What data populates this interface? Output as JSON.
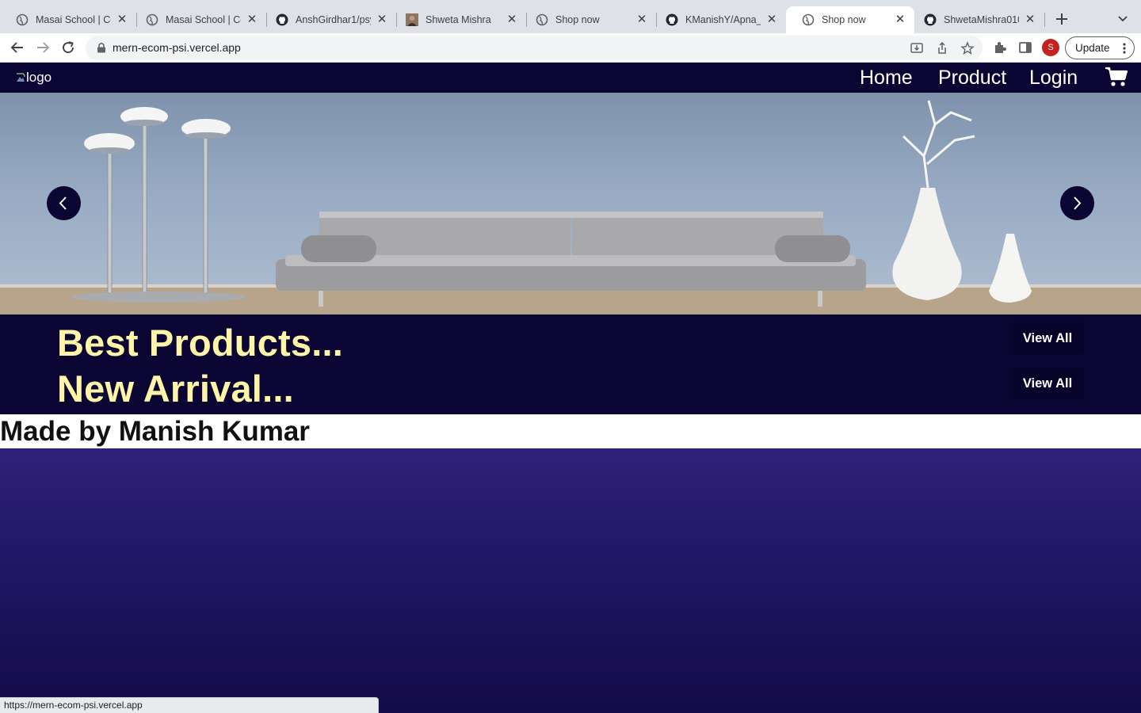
{
  "browser": {
    "tabs": [
      {
        "title": "Masai School | Co",
        "icon": "globe-icon",
        "active": false
      },
      {
        "title": "Masai School | Co",
        "icon": "globe-icon",
        "active": false
      },
      {
        "title": "AnshGirdhar1/psy",
        "icon": "github-icon",
        "active": false
      },
      {
        "title": "Shweta Mishra",
        "icon": "profile-photo-icon",
        "active": false
      },
      {
        "title": "Shop now",
        "icon": "globe-icon",
        "active": false
      },
      {
        "title": "KManishY/Apna_",
        "icon": "github-icon",
        "active": false
      },
      {
        "title": "Shop now",
        "icon": "globe-icon",
        "active": true
      },
      {
        "title": "ShwetaMishra010",
        "icon": "github-icon",
        "active": false
      }
    ],
    "url": "mern-ecom-psi.vercel.app",
    "profile_initial": "S",
    "update_label": "Update",
    "status_url": "https://mern-ecom-psi.vercel.app"
  },
  "site": {
    "logo_alt": "logo",
    "nav": {
      "home": "Home",
      "product": "Product",
      "login": "Login"
    },
    "sections": [
      {
        "title": "Best Products...",
        "button": "View All"
      },
      {
        "title": "New Arrival...",
        "button": "View All"
      }
    ],
    "footer": "Made by Manish Kumar"
  },
  "colors": {
    "nav_bg": "#0b0534",
    "section_title": "#fff5a8",
    "page_bg": "#1f1562"
  }
}
